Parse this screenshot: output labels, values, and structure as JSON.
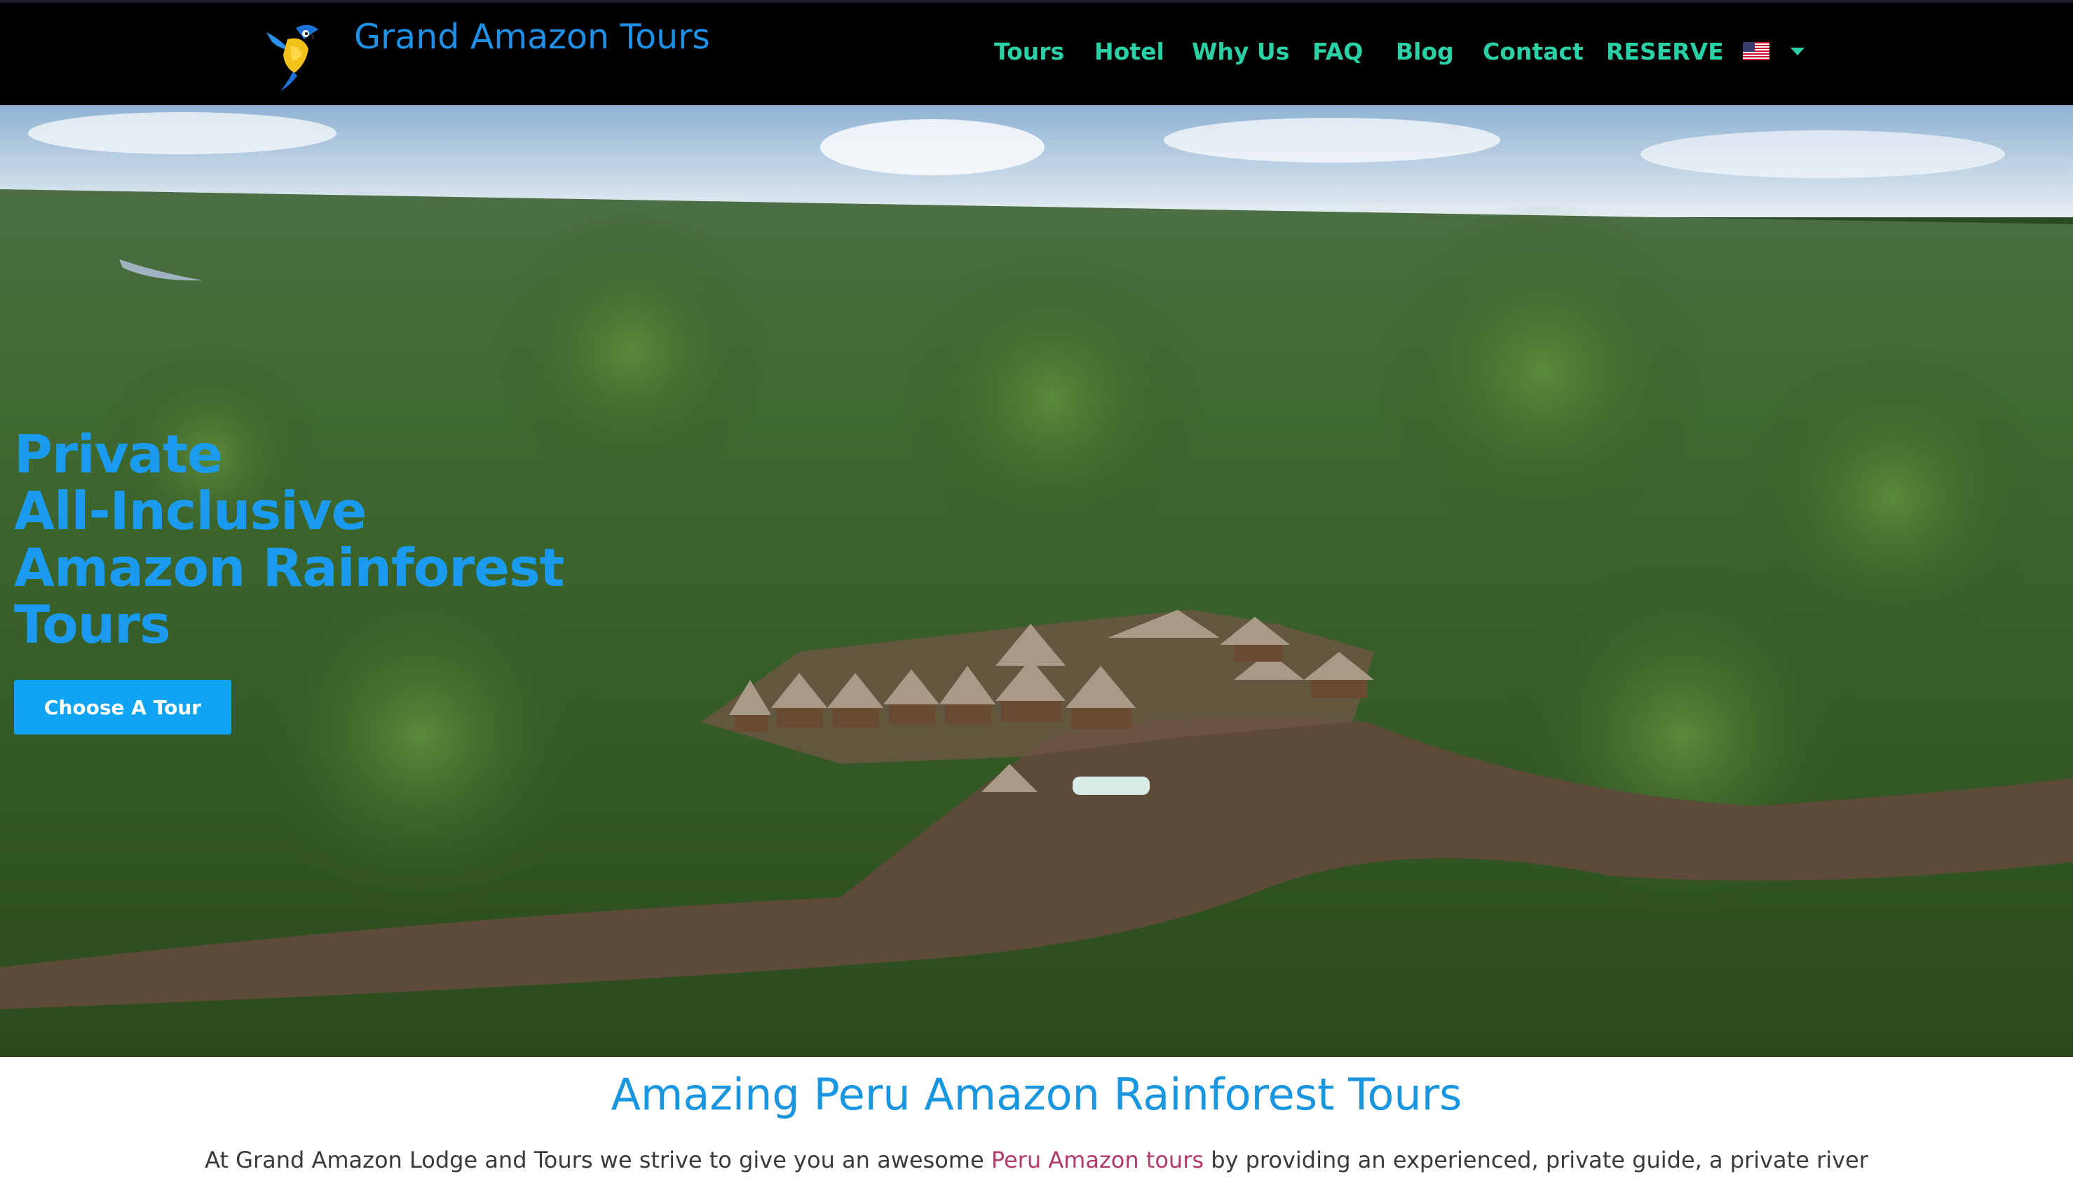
{
  "header": {
    "site_title": "Grand Amazon Tours",
    "logo_icon": "macaw-icon",
    "nav": [
      {
        "label": "Tours"
      },
      {
        "label": "Hotel"
      },
      {
        "label": "Why Us"
      },
      {
        "label": "FAQ"
      },
      {
        "label": "Blog"
      },
      {
        "label": "Contact"
      },
      {
        "label": "RESERVE"
      }
    ],
    "language_icon": "us-flag-icon"
  },
  "hero": {
    "title_lines": [
      "Private",
      "All-Inclusive",
      "Amazon Rainforest",
      "Tours"
    ],
    "cta_label": "Choose A Tour",
    "background": "aerial-rainforest-lodge-photo"
  },
  "intro": {
    "heading": "Amazing Peru Amazon Rainforest Tours",
    "text_before": "At Grand Amazon Lodge and Tours we strive to give you an awesome ",
    "link_text": "Peru Amazon tours",
    "text_after": " by providing an experienced, private guide, a private river"
  },
  "colors": {
    "header_bg": "#000000",
    "title_blue": "#1e90e6",
    "nav_green": "#2ad1a6",
    "hero_blue": "#1a9bf0",
    "button_blue": "#10a4f5",
    "link_magenta": "#b23a6a"
  }
}
